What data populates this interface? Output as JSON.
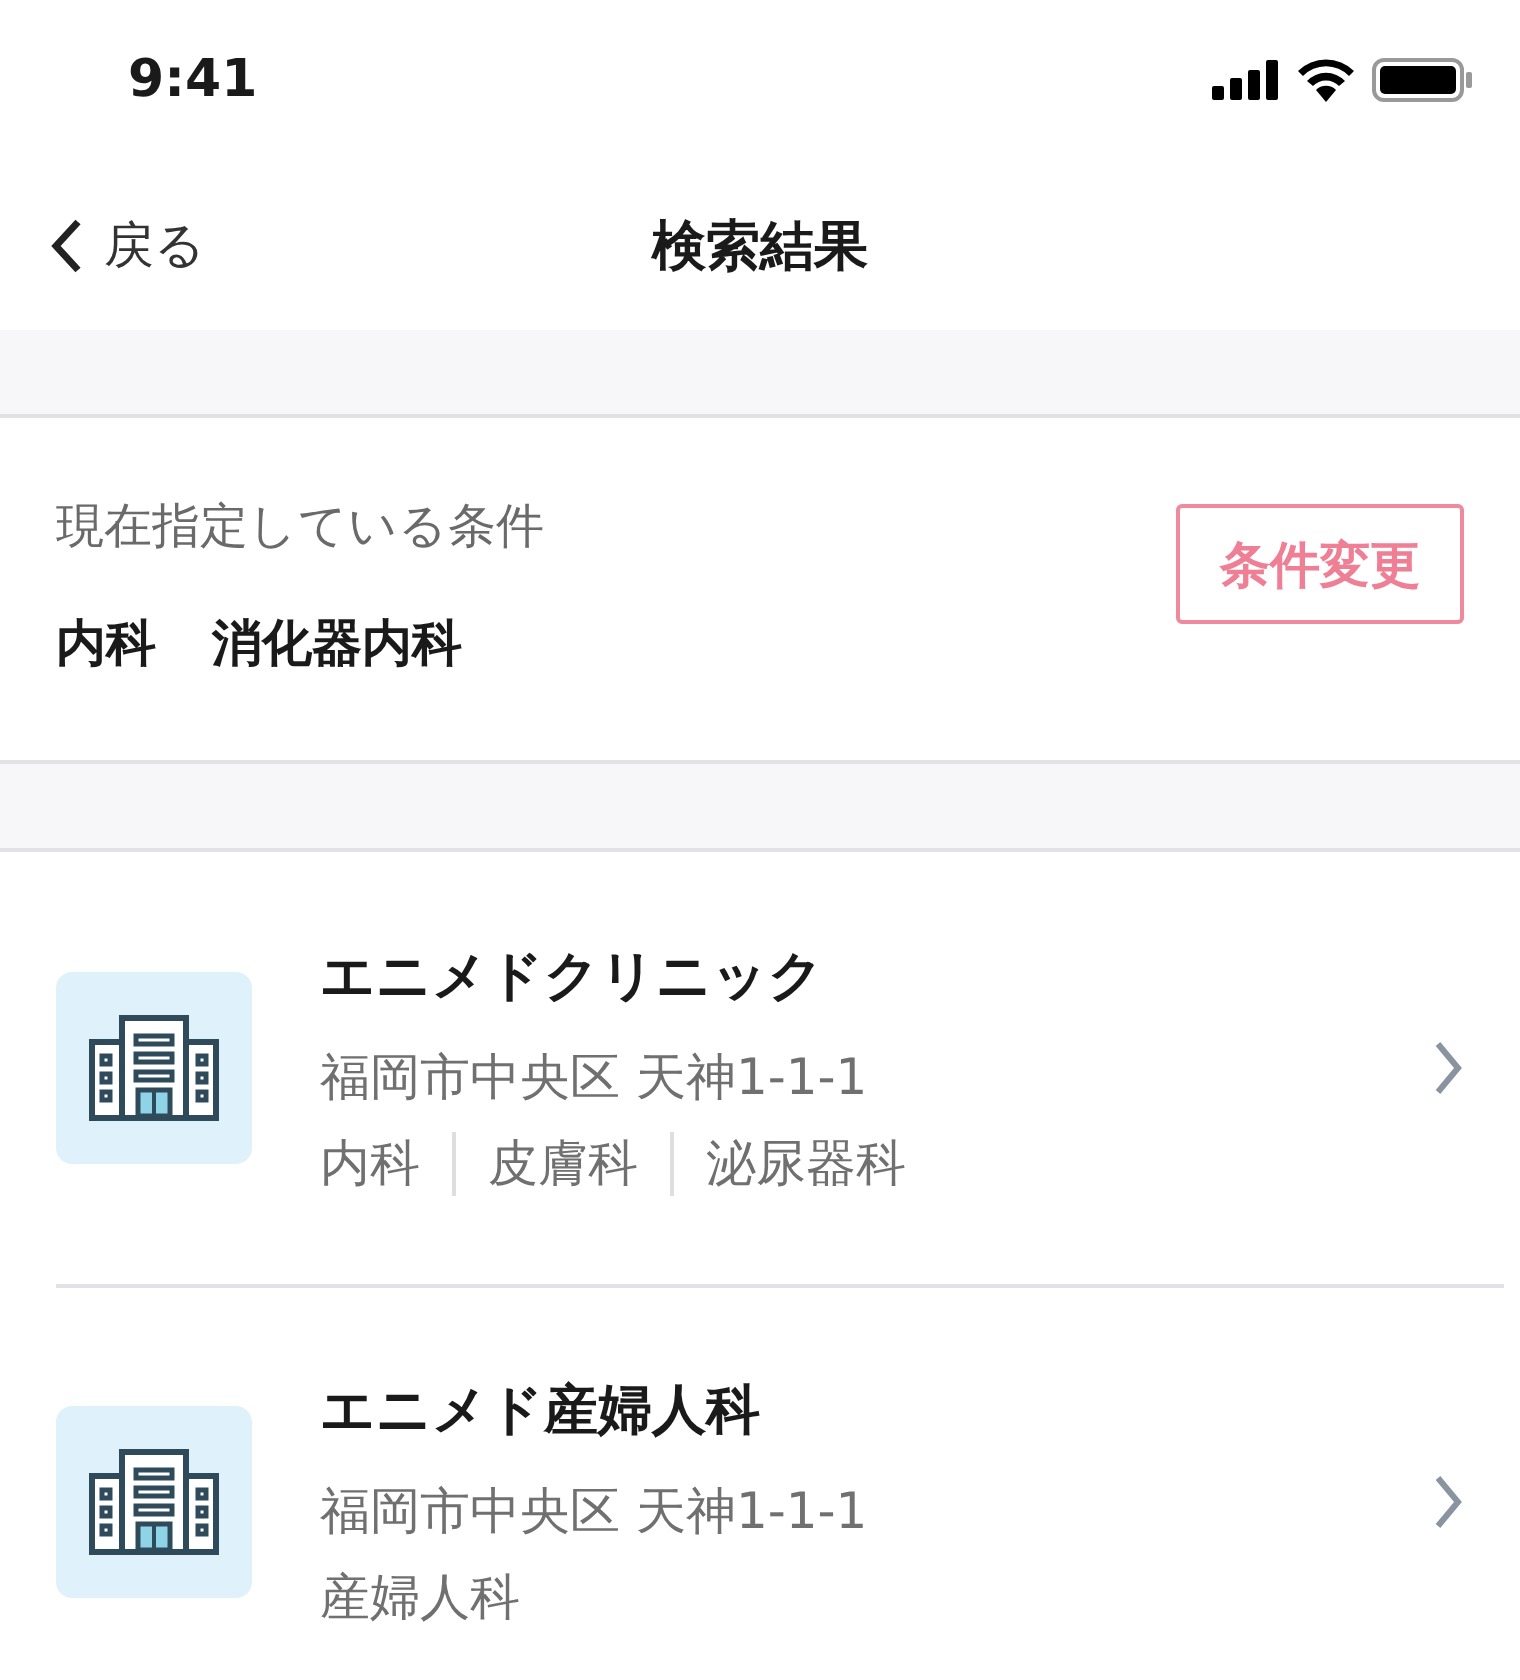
{
  "status_bar": {
    "time": "9:41"
  },
  "nav": {
    "back": "戻る",
    "title": "検索結果"
  },
  "conditions": {
    "heading": "現在指定している条件",
    "tags": [
      "内科",
      "消化器内科"
    ],
    "change_button": "条件変更"
  },
  "results": [
    {
      "name": "エニメドクリニック",
      "address": "福岡市中央区 天神1-1-1",
      "departments": [
        "内科",
        "皮膚科",
        "泌尿器科"
      ]
    },
    {
      "name": "エニメド産婦人科",
      "address": "福岡市中央区 天神1-1-1",
      "departments": [
        "産婦人科"
      ]
    }
  ]
}
